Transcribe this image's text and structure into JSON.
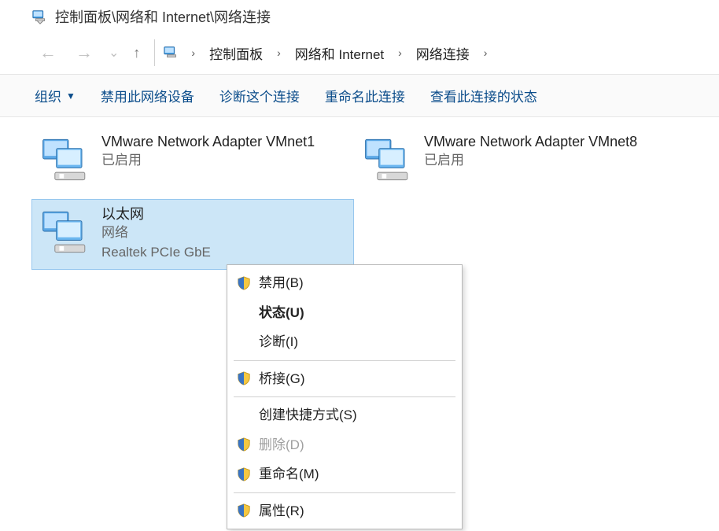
{
  "window": {
    "title": "控制面板\\网络和 Internet\\网络连接"
  },
  "breadcrumb": {
    "items": [
      "控制面板",
      "网络和 Internet",
      "网络连接"
    ]
  },
  "toolbar": {
    "organize": "组织",
    "disable": "禁用此网络设备",
    "diagnose": "诊断这个连接",
    "rename": "重命名此连接",
    "view_status": "查看此连接的状态"
  },
  "adapters": [
    {
      "name": "VMware Network Adapter VMnet1",
      "status": "已启用",
      "device": ""
    },
    {
      "name": "VMware Network Adapter VMnet8",
      "status": "已启用",
      "device": ""
    },
    {
      "name": "以太网",
      "status": "网络",
      "device": "Realtek PCIe GbE"
    }
  ],
  "context_menu": {
    "disable": "禁用(B)",
    "status": "状态(U)",
    "diagnose": "诊断(I)",
    "bridge": "桥接(G)",
    "shortcut": "创建快捷方式(S)",
    "delete": "删除(D)",
    "rename": "重命名(M)",
    "properties": "属性(R)"
  }
}
